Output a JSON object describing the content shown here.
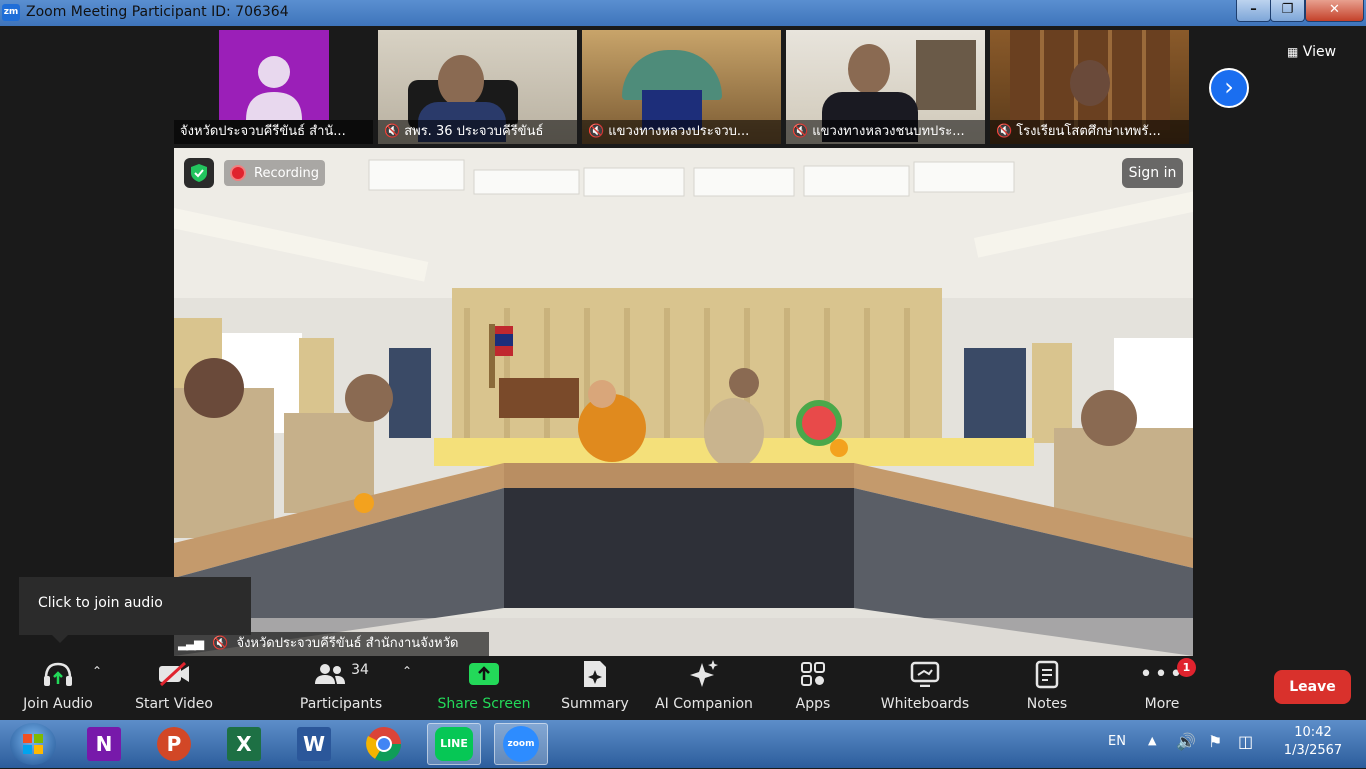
{
  "window": {
    "title": "Zoom Meeting Participant ID: 706364",
    "app_icon": "zm"
  },
  "thumbnails": [
    {
      "label": "จังหวัดประจวบคีรีขันธ์ สำนั...",
      "muted": false
    },
    {
      "label": "สพร. 36 ประจวบคีรีขันธ์",
      "muted": true
    },
    {
      "label": "แขวงทางหลวงประจวบ...",
      "muted": true
    },
    {
      "label": "แขวงทางหลวงชนบทประ...",
      "muted": true
    },
    {
      "label": "โรงเรียนโสตศึกษาเทพรั...",
      "muted": true
    }
  ],
  "view_label": "View",
  "main_video": {
    "recording_label": "Recording",
    "sign_in_label": "Sign in",
    "speaker_label": "จังหวัดประจวบคีรีขันธ์ สำนักงานจังหวัด"
  },
  "tooltip": "Click to join audio",
  "toolbar": {
    "join_audio": "Join Audio",
    "start_video": "Start Video",
    "participants": "Participants",
    "participants_count": "34",
    "share_screen": "Share Screen",
    "summary": "Summary",
    "ai_companion": "AI Companion",
    "apps": "Apps",
    "whiteboards": "Whiteboards",
    "notes": "Notes",
    "more": "More",
    "more_badge": "1",
    "leave": "Leave"
  },
  "taskbar": {
    "apps": [
      "windows-start",
      "onenote",
      "powerpoint",
      "excel",
      "word",
      "chrome",
      "line",
      "zoom"
    ],
    "lang": "EN",
    "time": "10:42",
    "date": "1/3/2567"
  },
  "colors": {
    "share_green": "#23d959",
    "leave_red": "#d9312c",
    "zoom_blue": "#1a6ef0"
  }
}
